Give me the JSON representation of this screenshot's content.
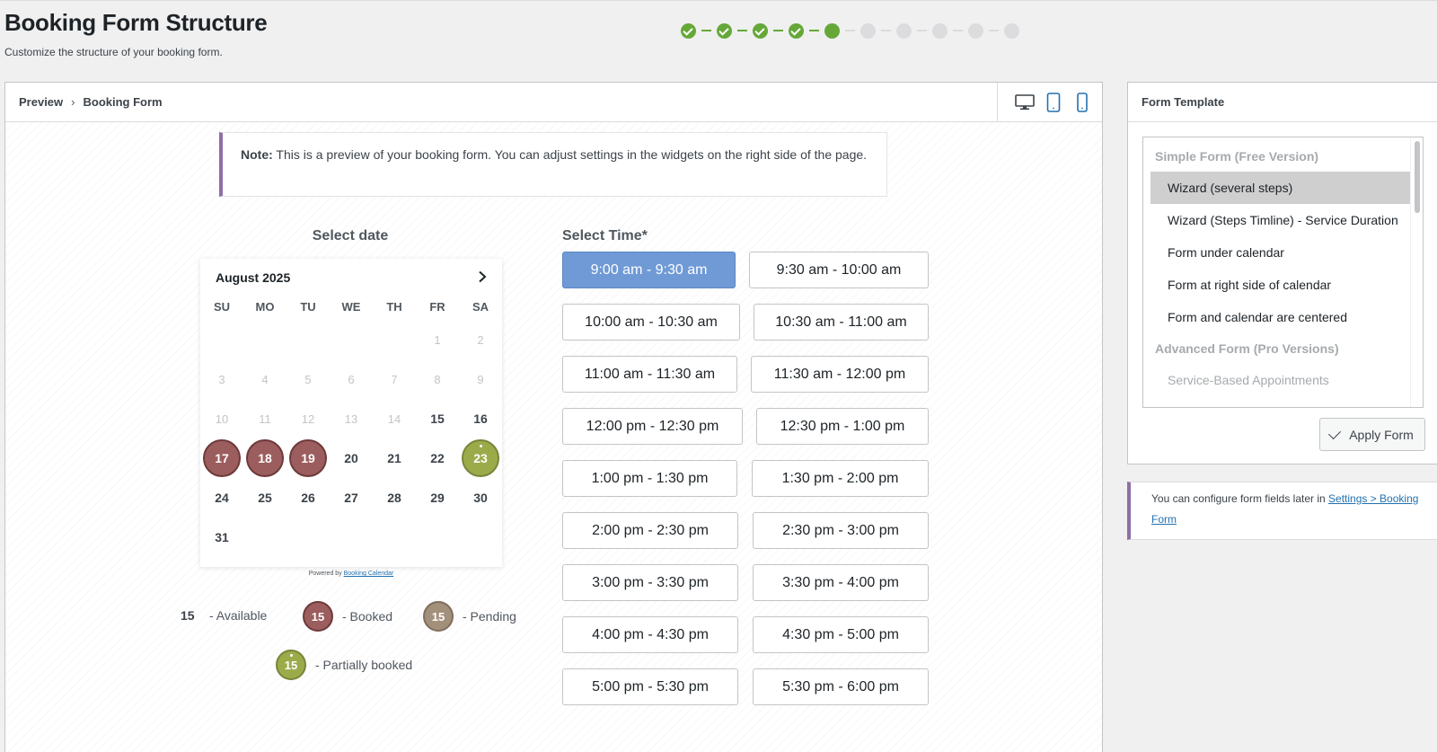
{
  "header": {
    "title": "Booking Form Structure",
    "subtitle": "Customize the structure of your booking form."
  },
  "wizard": {
    "total_steps": 10,
    "completed_steps": 4,
    "current_step": 5
  },
  "preview": {
    "breadcrumb": [
      "Preview",
      "Booking Form"
    ],
    "devices": [
      "desktop-icon",
      "tablet-icon",
      "mobile-icon"
    ],
    "note_label": "Note:",
    "note_text": "This is a preview of your booking form. You can adjust settings in the widgets on the right side of the page."
  },
  "calendar": {
    "label": "Select date",
    "month": "August 2025",
    "weekdays": [
      "SU",
      "MO",
      "TU",
      "WE",
      "TH",
      "FR",
      "SA"
    ],
    "weeks": [
      [
        null,
        null,
        null,
        null,
        null,
        {
          "d": "1",
          "s": "muted"
        },
        {
          "d": "2",
          "s": "muted"
        }
      ],
      [
        {
          "d": "3",
          "s": "muted"
        },
        {
          "d": "4",
          "s": "muted"
        },
        {
          "d": "5",
          "s": "muted"
        },
        {
          "d": "6",
          "s": "muted"
        },
        {
          "d": "7",
          "s": "muted"
        },
        {
          "d": "8",
          "s": "muted"
        },
        {
          "d": "9",
          "s": "muted"
        }
      ],
      [
        {
          "d": "10",
          "s": "muted"
        },
        {
          "d": "11",
          "s": "muted"
        },
        {
          "d": "12",
          "s": "muted"
        },
        {
          "d": "13",
          "s": "muted"
        },
        {
          "d": "14",
          "s": "muted"
        },
        {
          "d": "15",
          "s": "avail"
        },
        {
          "d": "16",
          "s": "avail"
        }
      ],
      [
        {
          "d": "17",
          "s": "booked"
        },
        {
          "d": "18",
          "s": "booked"
        },
        {
          "d": "19",
          "s": "booked"
        },
        {
          "d": "20",
          "s": "avail"
        },
        {
          "d": "21",
          "s": "avail"
        },
        {
          "d": "22",
          "s": "avail"
        },
        {
          "d": "23",
          "s": "partial"
        }
      ],
      [
        {
          "d": "24",
          "s": "avail"
        },
        {
          "d": "25",
          "s": "avail"
        },
        {
          "d": "26",
          "s": "avail"
        },
        {
          "d": "27",
          "s": "avail"
        },
        {
          "d": "28",
          "s": "avail"
        },
        {
          "d": "29",
          "s": "avail"
        },
        {
          "d": "30",
          "s": "avail"
        }
      ],
      [
        {
          "d": "31",
          "s": "avail"
        },
        null,
        null,
        null,
        null,
        null,
        null
      ]
    ],
    "powered_by": "Powered by",
    "powered_link": "Booking Calendar"
  },
  "legend": {
    "sample": "15",
    "available": "- Available",
    "booked": "- Booked",
    "pending": "- Pending",
    "partial": "- Partially booked"
  },
  "time": {
    "label": "Select Time*",
    "slots": [
      "9:00 am - 9:30 am",
      "9:30 am - 10:00 am",
      "10:00 am - 10:30 am",
      "10:30 am - 11:00 am",
      "11:00 am - 11:30 am",
      "11:30 am - 12:00 pm",
      "12:00 pm - 12:30 pm",
      "12:30 pm - 1:00 pm",
      "1:00 pm - 1:30 pm",
      "1:30 pm - 2:00 pm",
      "2:00 pm - 2:30 pm",
      "2:30 pm - 3:00 pm",
      "3:00 pm - 3:30 pm",
      "3:30 pm - 4:00 pm",
      "4:00 pm - 4:30 pm",
      "4:30 pm - 5:00 pm",
      "5:00 pm - 5:30 pm",
      "5:30 pm - 6:00 pm"
    ],
    "selected_index": 0
  },
  "template": {
    "title": "Form Template",
    "group_free": "Simple Form (Free Version)",
    "free_options": [
      "Wizard (several steps)",
      "Wizard (Steps Timline) - Service Duration",
      "Form under calendar",
      "Form at right side of calendar",
      "Form and calendar are centered"
    ],
    "selected_option": 0,
    "group_pro": "Advanced Form (Pro Versions)",
    "pro_options": [
      "Service-Based Appointments"
    ],
    "apply_label": "Apply Form"
  },
  "config_note": {
    "text": "You can configure form fields later in",
    "link": "Settings > Booking Form"
  },
  "colors": {
    "accent_green": "#65a838",
    "booked": "#9b5d5d",
    "pending": "#a3907b",
    "partial": "#9bab4a",
    "selected_slot": "#6f9ad6",
    "note_border": "#8e6fa6"
  }
}
